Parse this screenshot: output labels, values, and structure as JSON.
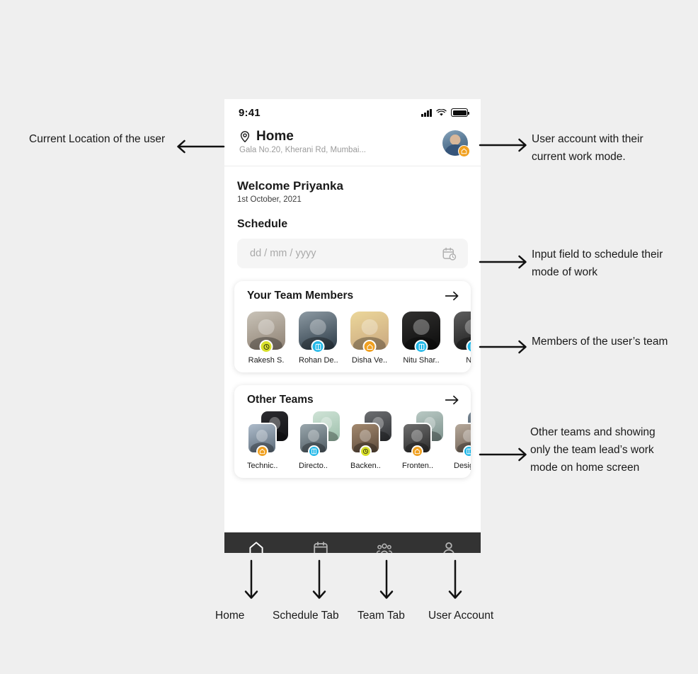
{
  "phone": {
    "status_bar": {
      "time": "9:41",
      "signal_icon": "cellular-signal-icon",
      "wifi_icon": "wifi-icon",
      "battery_icon": "battery-icon"
    },
    "header": {
      "location_icon": "map-pin-icon",
      "location_title": "Home",
      "location_address": "Gala No.20, Kherani Rd, Mumbai...",
      "avatar_name": "user-avatar",
      "avatar_mode": "work-from-home",
      "avatar_mode_color": "#f0a020"
    },
    "welcome": {
      "title": "Welcome Priyanka",
      "date": "1st October, 2021"
    },
    "schedule": {
      "label": "Schedule",
      "input_placeholder": "dd / mm / yyyy",
      "input_value": "",
      "calendar_icon": "calendar-clock-icon"
    },
    "team_members": {
      "title": "Your Team Members",
      "arrow_icon": "arrow-right-icon",
      "members": [
        {
          "name": "Rakesh S.",
          "mode": "remote",
          "badge_color": "#d8e02a",
          "photo_a": "#c9c3b8",
          "photo_b": "#8e8173"
        },
        {
          "name": "Rohan De..",
          "mode": "office",
          "badge_color": "#22b8e8",
          "photo_a": "#8d9aa3",
          "photo_b": "#2b3a46"
        },
        {
          "name": "Disha Ve..",
          "mode": "work-from-home",
          "badge_color": "#f0a020",
          "photo_a": "#ecd79a",
          "photo_b": "#c9a77f"
        },
        {
          "name": "Nitu Shar..",
          "mode": "office",
          "badge_color": "#22b8e8",
          "photo_a": "#31302f",
          "photo_b": "#0c0c0c"
        },
        {
          "name": "Nitu",
          "mode": "office",
          "badge_color": "#22b8e8",
          "photo_a": "#5e5e5e",
          "photo_b": "#171717"
        }
      ]
    },
    "other_teams": {
      "title": "Other Teams",
      "arrow_icon": "arrow-right-icon",
      "teams": [
        {
          "name": "Technic..",
          "mode": "work-from-home",
          "badge_color": "#f0a020",
          "back_a": "#2b2b2f",
          "back_b": "#111114",
          "front_a": "#aebccb",
          "front_b": "#5b6a78"
        },
        {
          "name": "Directo..",
          "mode": "office",
          "badge_color": "#22b8e8",
          "back_a": "#cfe3d6",
          "back_b": "#9dbfab",
          "front_a": "#9aa7ad",
          "front_b": "#4f5b63"
        },
        {
          "name": "Backen..",
          "mode": "remote",
          "badge_color": "#d8e02a",
          "back_a": "#6d6f72",
          "back_b": "#303235",
          "front_a": "#a3896f",
          "front_b": "#5d4a3a"
        },
        {
          "name": "Fronten..",
          "mode": "work-from-home",
          "badge_color": "#f0a020",
          "back_a": "#b9c9c4",
          "back_b": "#7d918c",
          "front_a": "#6e6e6e",
          "front_b": "#2b2b2b"
        },
        {
          "name": "Design..",
          "mode": "office",
          "badge_color": "#22b8e8",
          "back_a": "#7b8a96",
          "back_b": "#3b4752",
          "front_a": "#b6a99b",
          "front_b": "#6d5f53"
        }
      ]
    },
    "tabbar": {
      "tabs": [
        {
          "icon": "home-icon",
          "active": true
        },
        {
          "icon": "calendar-icon",
          "active": false
        },
        {
          "icon": "team-people-icon",
          "active": false
        },
        {
          "icon": "user-person-icon",
          "active": false
        }
      ],
      "active_color": "#ffffff",
      "inactive_color": "#b4b4b4"
    }
  },
  "annotations": {
    "left": [
      {
        "text": "Current Location of the user",
        "arrow": "arrow-left"
      }
    ],
    "right": [
      {
        "text": "User account with their current work mode.",
        "arrow": "arrow-right"
      },
      {
        "text": "Input field to schedule their mode of work",
        "arrow": "arrow-right"
      },
      {
        "text": "Members of the user’s team",
        "arrow": "arrow-right"
      },
      {
        "text": "Other teams and showing only the team lead’s work mode on home screen",
        "arrow": "arrow-right"
      }
    ],
    "bottom": [
      {
        "text": "Home",
        "arrow": "arrow-down"
      },
      {
        "text": "Schedule Tab",
        "arrow": "arrow-down"
      },
      {
        "text": "Team Tab",
        "arrow": "arrow-down"
      },
      {
        "text": "User Account",
        "arrow": "arrow-down"
      }
    ]
  }
}
